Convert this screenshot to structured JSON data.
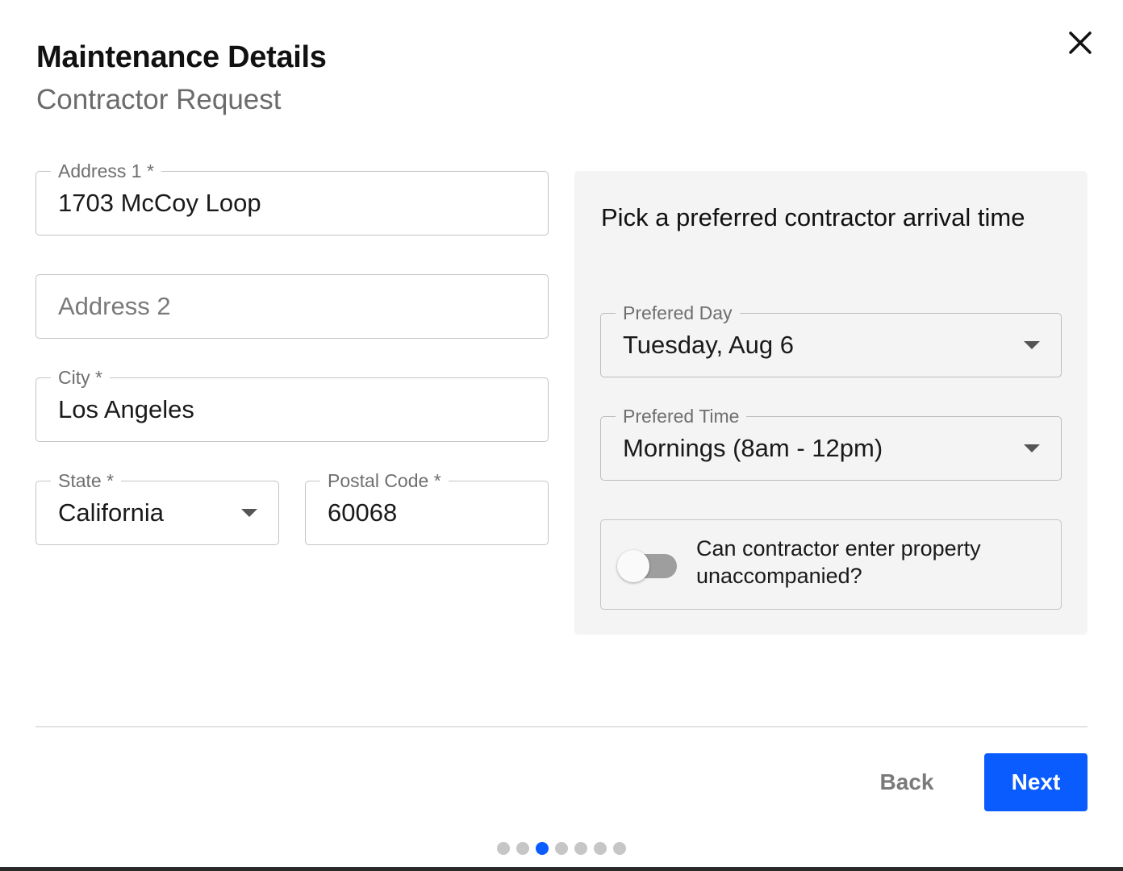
{
  "header": {
    "title": "Maintenance Details",
    "subtitle": "Contractor Request"
  },
  "form": {
    "address1": {
      "label": "Address 1 *",
      "value": "1703 McCoy Loop"
    },
    "address2": {
      "placeholder": "Address 2",
      "value": ""
    },
    "city": {
      "label": "City *",
      "value": "Los Angeles"
    },
    "state": {
      "label": "State *",
      "value": "California"
    },
    "postal_code": {
      "label": "Postal Code *",
      "value": "60068"
    }
  },
  "arrival": {
    "heading": "Pick a preferred contractor arrival time",
    "day": {
      "label": "Prefered Day",
      "value": "Tuesday, Aug 6"
    },
    "time": {
      "label": "Prefered Time",
      "value": "Mornings (8am - 12pm)"
    },
    "unaccompanied": {
      "label": "Can contractor enter property unaccompanied?",
      "checked": false
    }
  },
  "footer": {
    "back_label": "Back",
    "next_label": "Next"
  },
  "stepper": {
    "total_steps": 7,
    "current_step": 3
  },
  "colors": {
    "primary": "#0a5cff",
    "panel_background": "#f4f4f4",
    "inactive_dot": "#c6c6c6"
  }
}
